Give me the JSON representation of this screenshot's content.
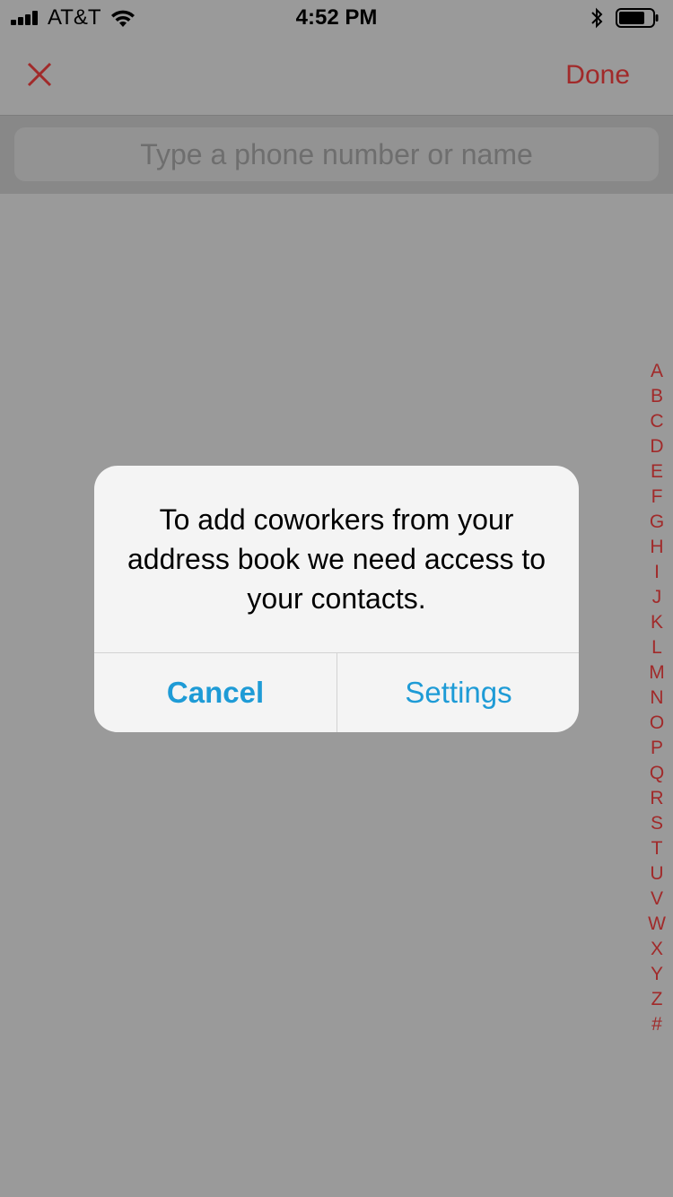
{
  "status_bar": {
    "carrier": "AT&T",
    "time": "4:52 PM",
    "icons": [
      "signal-icon",
      "wifi-icon",
      "bluetooth-icon",
      "battery-icon"
    ]
  },
  "nav": {
    "close_icon": "close-icon",
    "done_label": "Done"
  },
  "search": {
    "placeholder": "Type a phone number or name",
    "value": ""
  },
  "index_letters": [
    "A",
    "B",
    "C",
    "D",
    "E",
    "F",
    "G",
    "H",
    "I",
    "J",
    "K",
    "L",
    "M",
    "N",
    "O",
    "P",
    "Q",
    "R",
    "S",
    "T",
    "U",
    "V",
    "W",
    "X",
    "Y",
    "Z",
    "#"
  ],
  "alert": {
    "message": "To add coworkers from your address book we need access to your contacts.",
    "cancel_label": "Cancel",
    "settings_label": "Settings"
  },
  "colors": {
    "accent_red": "#a12a2a",
    "alert_button_blue": "#1e9bd6",
    "dim_overlay_gray": "#9a9a9a"
  }
}
